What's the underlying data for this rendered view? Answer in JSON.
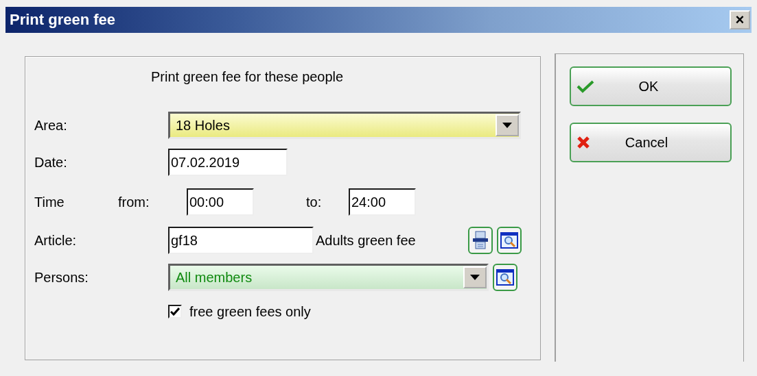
{
  "window": {
    "title": "Print green fee",
    "close": "×"
  },
  "heading": "Print green fee for these people",
  "area": {
    "label": "Area:",
    "value": "18 Holes"
  },
  "date": {
    "label": "Date:",
    "value": "07.02.2019"
  },
  "time": {
    "label": "Time",
    "from_label": "from:",
    "from": "00:00",
    "to_label": "to:",
    "to": "24:00"
  },
  "article": {
    "label": "Article:",
    "value": "gf18",
    "description": "Adults green fee"
  },
  "persons": {
    "label": "Persons:",
    "value": "All members"
  },
  "free_only": {
    "label": "free green fees only",
    "checked": true
  },
  "buttons": [
    {
      "kind": "ok",
      "label": "OK"
    },
    {
      "kind": "cancel",
      "label": "Cancel"
    }
  ]
}
